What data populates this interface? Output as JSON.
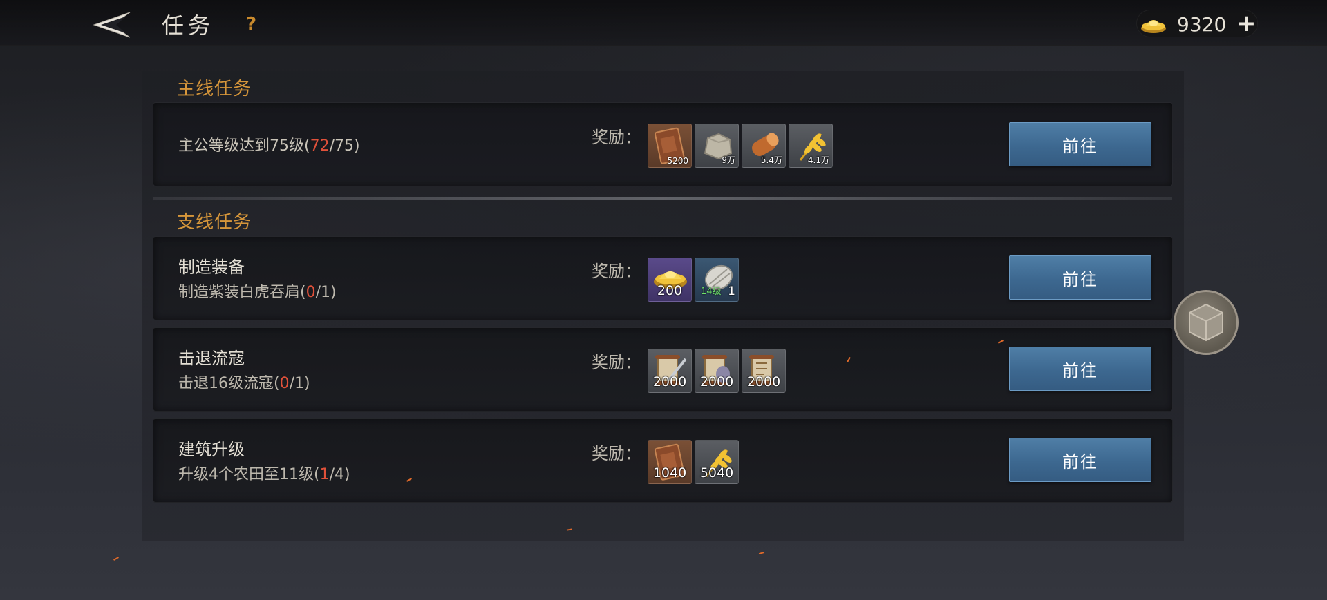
{
  "header": {
    "title": "任务",
    "help": "?",
    "currency": {
      "value": "9320",
      "plus": "+"
    }
  },
  "main_section": {
    "title": "主线任务",
    "tasks": [
      {
        "desc_prefix": "主公等级达到75级(",
        "progress_current": "72",
        "progress_rest": "/75)",
        "reward_label": "奖励：",
        "rewards": [
          {
            "icon": "book-icon",
            "qty": "5200"
          },
          {
            "icon": "stone-icon",
            "qty": "9万"
          },
          {
            "icon": "wood-log-icon",
            "qty": "5.4万"
          },
          {
            "icon": "wheat-icon",
            "qty": "4.1万"
          }
        ],
        "button": "前往"
      }
    ]
  },
  "side_section": {
    "title": "支线任务",
    "tasks": [
      {
        "name": "制造装备",
        "desc_prefix": "制造紫装白虎吞肩(",
        "progress_current": "0",
        "progress_rest": "/1)",
        "reward_label": "奖励：",
        "rewards": [
          {
            "icon": "gold-ingot-icon",
            "qty": "200"
          },
          {
            "icon": "shoulder-armor-icon",
            "qty": "1",
            "tag": "14级"
          }
        ],
        "button": "前往"
      },
      {
        "name": "击退流寇",
        "desc_prefix": "击退16级流寇(",
        "progress_current": "0",
        "progress_rest": "/1)",
        "reward_label": "奖励：",
        "rewards": [
          {
            "icon": "scroll-sword-icon",
            "qty": "2000"
          },
          {
            "icon": "scroll-bag-icon",
            "qty": "2000"
          },
          {
            "icon": "scroll-icon",
            "qty": "2000"
          }
        ],
        "button": "前往"
      },
      {
        "name": "建筑升级",
        "desc_prefix": "升级4个农田至11级(",
        "progress_current": "1",
        "progress_rest": "/4)",
        "reward_label": "奖励：",
        "rewards": [
          {
            "icon": "book-icon",
            "qty": "1040"
          },
          {
            "icon": "wheat-icon",
            "qty": "5040"
          }
        ],
        "button": "前往"
      }
    ]
  },
  "colors": {
    "section_title": "#d6963a",
    "progress_highlight": "#e0513a",
    "button": "#3d6890"
  }
}
